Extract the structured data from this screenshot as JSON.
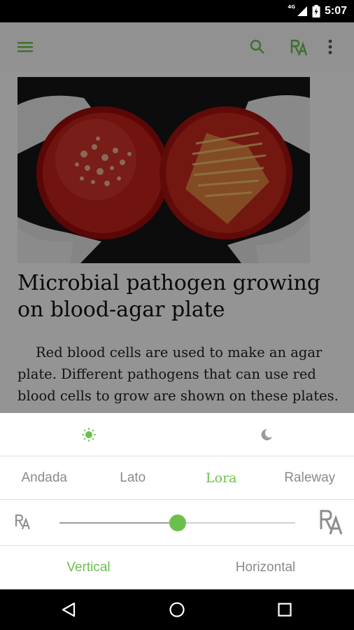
{
  "status_bar": {
    "time": "5:07",
    "network_label": "4G",
    "icons": [
      "signal-icon",
      "battery-icon"
    ]
  },
  "app_bar": {
    "icons": [
      "menu-icon",
      "search-icon",
      "font-size-icon",
      "more-vert-icon"
    ],
    "accent_color": "#6bc04b"
  },
  "article": {
    "image_alt": "Two blood-agar petri dishes held in gloved hands",
    "title": "Microbial pathogen growing on blood-agar plate",
    "body": "Red blood cells are used to make an agar plate. Different pathogens that can use red blood cells to grow are shown on these plates."
  },
  "settings": {
    "themes": [
      {
        "name": "light",
        "icon": "sun-icon",
        "active": true
      },
      {
        "name": "dark",
        "icon": "moon-icon",
        "active": false
      }
    ],
    "fonts": [
      {
        "label": "Andada",
        "active": false
      },
      {
        "label": "Lato",
        "active": false
      },
      {
        "label": "Lora",
        "active": true
      },
      {
        "label": "Raleway",
        "active": false
      }
    ],
    "font_size_slider": {
      "value": 0.5
    },
    "layouts": [
      {
        "label": "Vertical",
        "active": true
      },
      {
        "label": "Horizontal",
        "active": false
      }
    ]
  },
  "nav_bar": {
    "icons": [
      "back-icon",
      "home-icon",
      "recents-icon"
    ]
  }
}
